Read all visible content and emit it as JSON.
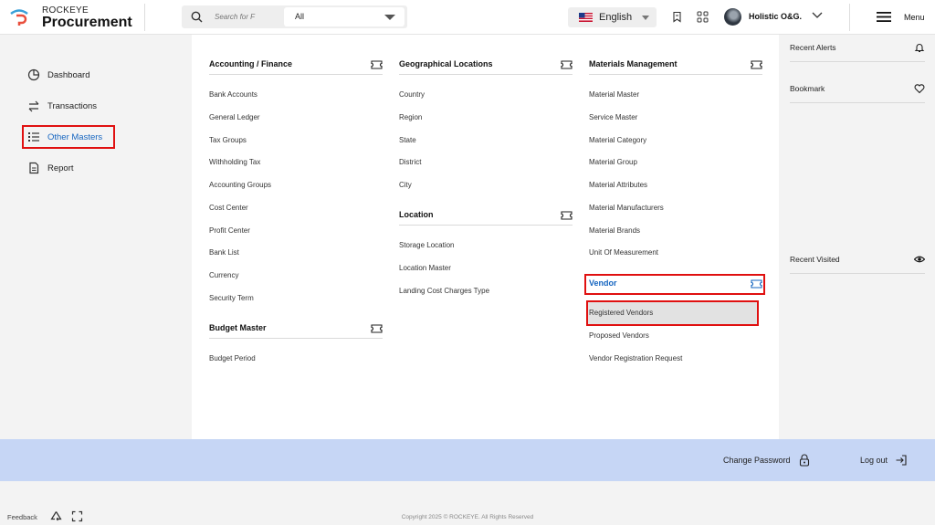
{
  "brand": {
    "small": "ROCKEYE",
    "big": "Procurement"
  },
  "search": {
    "placeholder": "Search for F",
    "filter": "All"
  },
  "language": {
    "label": "English",
    "flag_icon": "us-flag-icon"
  },
  "user": {
    "name": "Holistic O&G."
  },
  "menu": {
    "label": "Menu"
  },
  "sidebar": {
    "items": [
      {
        "label": "Dashboard",
        "icon": "pie-chart-icon",
        "active": false
      },
      {
        "label": "Transactions",
        "icon": "arrows-swap-icon",
        "active": false
      },
      {
        "label": "Other Masters",
        "icon": "list-icon",
        "active": true
      },
      {
        "label": "Report",
        "icon": "document-icon",
        "active": false
      }
    ]
  },
  "mega": {
    "accounting": {
      "title": "Accounting / Finance",
      "items": [
        "Bank Accounts",
        "General Ledger",
        "Tax Groups",
        "Withholding Tax",
        "Accounting Groups",
        "Cost Center",
        "Profit Center",
        "Bank List",
        "Currency",
        "Security Term"
      ]
    },
    "budget": {
      "title": "Budget Master",
      "items": [
        "Budget Period"
      ]
    },
    "geo": {
      "title": "Geographical Locations",
      "items": [
        "Country",
        "Region",
        "State",
        "District",
        "City"
      ]
    },
    "location": {
      "title": "Location",
      "items": [
        "Storage Location",
        "Location Master",
        "Landing Cost Charges Type"
      ]
    },
    "materials": {
      "title": "Materials Management",
      "items": [
        "Material Master",
        "Service Master",
        "Material Category",
        "Material Group",
        "Material Attributes",
        "Material Manufacturers",
        "Material Brands",
        "Unit Of Measurement"
      ]
    },
    "vendor": {
      "title": "Vendor",
      "items": [
        "Registered Vendors",
        "Proposed Vendors",
        "Vendor Registration Request"
      ],
      "selected": "Registered Vendors"
    }
  },
  "right_panel": {
    "recent_alerts": "Recent Alerts",
    "bookmark": "Bookmark",
    "recent_visited": "Recent Visited"
  },
  "bottom": {
    "change_password": "Change Password",
    "logout": "Log out"
  },
  "footer": {
    "feedback": "Feedback",
    "copyright": "Copyright 2025 © ROCKEYE. All Rights Reserved"
  },
  "colors": {
    "accent_blue": "#1565c0",
    "highlight_red": "#e01010",
    "bottom_bar": "#c6d6f5",
    "selected_bg": "#e2e2e2"
  }
}
